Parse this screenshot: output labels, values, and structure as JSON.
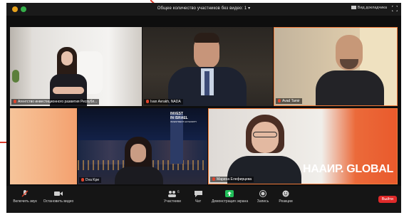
{
  "meeting": {
    "title": "Общее количество участников без видео: 1",
    "title_chevron": "▾",
    "view_button_label": "Вид докладчика",
    "fullscreen_icon": "fullscreen-icon"
  },
  "participants": [
    {
      "name": "Агентство инвестиционного развития Республ..."
    },
    {
      "name": "Ivan Avrakh, NADA"
    },
    {
      "name": "Avad Tamir"
    },
    {
      "name": ""
    },
    {
      "name": "Dva Kpe"
    },
    {
      "name": "Марина Елефирцева"
    }
  ],
  "banner": {
    "invest_line1": "INVEST",
    "invest_line2": "IN ISRAEL",
    "invest_line3": "INVESTMENT AUTHORITY",
    "naair_text": "НААИР. GLOBAL"
  },
  "toolbar": {
    "mic_label": "Включить звук",
    "video_label": "Остановить видео",
    "participants_label": "Участники",
    "participants_count": "6",
    "chat_label": "Чат",
    "share_label": "Демонстрация экрана",
    "record_label": "Запись",
    "reactions_label": "Реакции",
    "leave_label": "Выйти"
  },
  "colors": {
    "accent_orange": "#f07a3a",
    "leave_red": "#e02a2a",
    "share_green": "#22c05a",
    "mic_muted_red": "#e0442c"
  }
}
